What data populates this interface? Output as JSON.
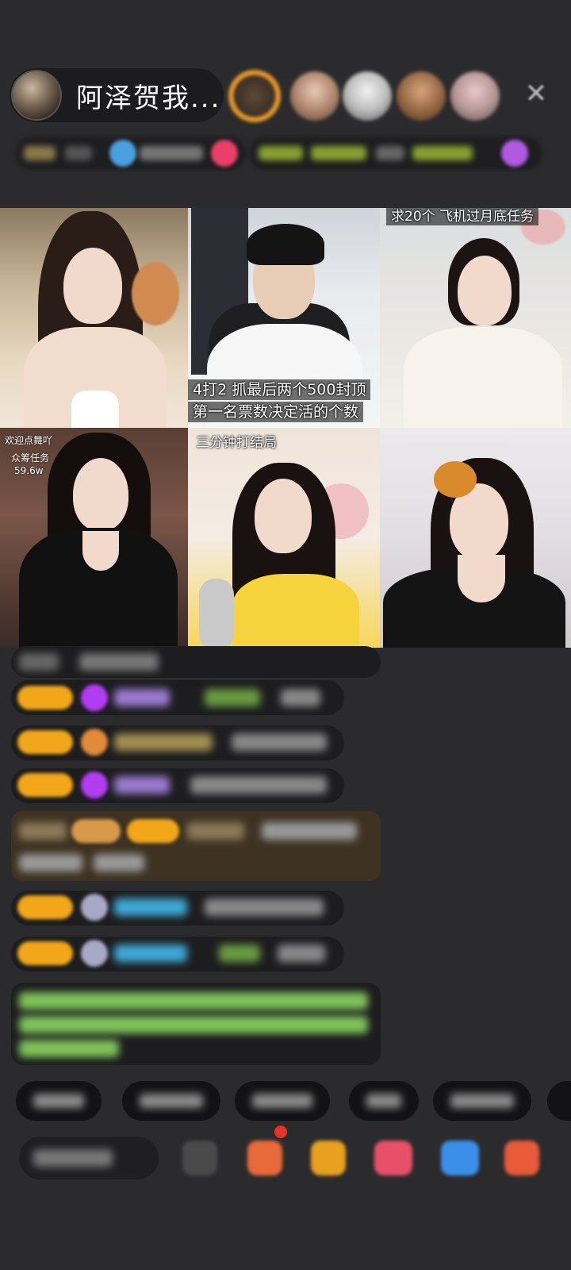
{
  "header": {
    "host_name": "阿泽贺我...",
    "close_icon": "close-icon"
  },
  "grid": {
    "cells": [
      {
        "id": 1,
        "overlay": ""
      },
      {
        "id": 2,
        "overlay_line1": "4打2  抓最后两个500封顶",
        "overlay_line2": "第一名票数决定活的个数"
      },
      {
        "id": 3,
        "overlay": "求20个 飞机过月底任务"
      },
      {
        "id": 4,
        "overlay_line1": "欢迎点舞吖",
        "overlay_line2": "众筹任务",
        "overlay_line3": "59.6w"
      },
      {
        "id": 5,
        "overlay": "三分钟打结局"
      },
      {
        "id": 6,
        "overlay": ""
      }
    ]
  },
  "colors": {
    "background": "#2b2b2d",
    "badge": "#f2a71a",
    "gem_purple": "#b23cf0",
    "chat_green": "#7fc35a",
    "chat_blue": "#3fa8d8"
  }
}
